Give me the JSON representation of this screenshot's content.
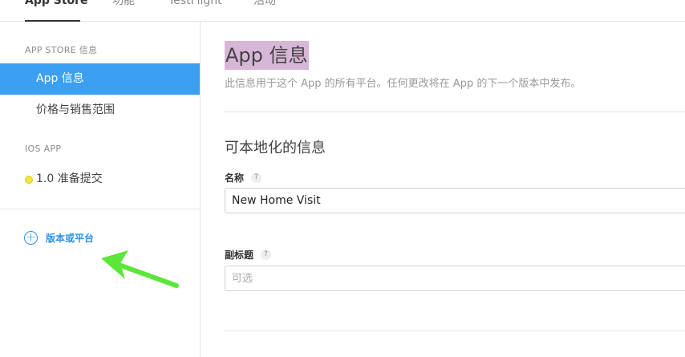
{
  "topnav": {
    "tabs": [
      {
        "label": "App Store",
        "active": true
      },
      {
        "label": "功能",
        "active": false
      },
      {
        "label": "TestFlight",
        "active": false
      },
      {
        "label": "活动",
        "active": false
      }
    ]
  },
  "sidebar": {
    "section_app_store": "APP STORE 信息",
    "items_app_store": [
      {
        "label": "App 信息",
        "active": true
      },
      {
        "label": "价格与销售范围",
        "active": false
      }
    ],
    "section_ios": "IOS APP",
    "ios_version": {
      "label": "1.0 准备提交",
      "status_color": "#f5e83a"
    },
    "add_version_label": "版本或平台"
  },
  "main": {
    "title": "App 信息",
    "subtitle": "此信息用于这个 App 的所有平台。任何更改将在 App 的下一个版本中发布。",
    "localizable_heading": "可本地化的信息",
    "name_field": {
      "label": "名称",
      "help": "?",
      "value": "New Home Visit"
    },
    "subtitle_field": {
      "label": "副标题",
      "help": "?",
      "placeholder": "可选"
    }
  },
  "colors": {
    "accent": "#3b9ff2",
    "link": "#2f8fe6",
    "title_highlight": "#d8b6d8",
    "annotation_arrow": "#5ce63a"
  }
}
